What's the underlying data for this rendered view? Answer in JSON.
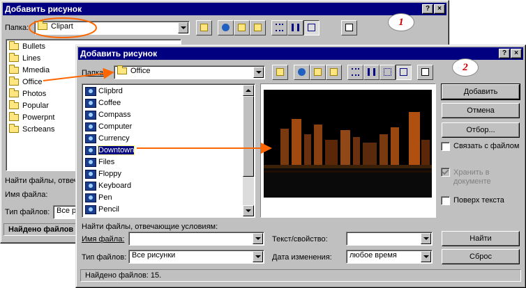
{
  "back_dialog": {
    "title": "Добавить рисунок",
    "help_btn": "?",
    "close_btn": "×",
    "folder_label": "Папка:",
    "folder_value": "Clipart",
    "folders": [
      "Bullets",
      "Lines",
      "Mmedia",
      "Office",
      "Photos",
      "Popular",
      "Powerpnt",
      "Scrbeans"
    ],
    "find_files_label": "Найти файлы, отвеча",
    "filename_label": "Имя файла:",
    "filetype_label": "Тип файлов:",
    "filetype_value": "Все ри",
    "status": "Найдено файлов"
  },
  "front_dialog": {
    "title": "Добавить рисунок",
    "help_btn": "?",
    "close_btn": "×",
    "folder_label": "Папка:",
    "folder_value": "Office",
    "files": [
      "Clipbrd",
      "Coffee",
      "Compass",
      "Computer",
      "Currency",
      "Downtown",
      "Files",
      "Floppy",
      "Keyboard",
      "Pen",
      "Pencil"
    ],
    "selected_file": "Downtown",
    "buttons": {
      "insert": "Добавить",
      "cancel": "Отмена",
      "select": "Отбор...",
      "find": "Найти",
      "reset": "Сброс"
    },
    "checkboxes": {
      "link_to_file": "Связать с файлом",
      "save_with_doc_line1": "Хранить в",
      "save_with_doc_line2": "документе",
      "float_over_text": "Поверх текста"
    },
    "find_files_label": "Найти файлы, отвечающие условиям:",
    "filename_label": "Имя файла:",
    "text_property_label": "Текст/свойство:",
    "filetype_label": "Тип файлов:",
    "filetype_value": "Все рисунки",
    "modified_label": "Дата изменения:",
    "modified_value": "любое время",
    "status": "Найдено файлов: 15."
  },
  "callouts": {
    "one": "1",
    "two": "2"
  },
  "colors": {
    "titlebar": "#000080",
    "dialog": "#c0c0c0",
    "arrow": "#ff6600",
    "callout_text": "#cc0000"
  }
}
